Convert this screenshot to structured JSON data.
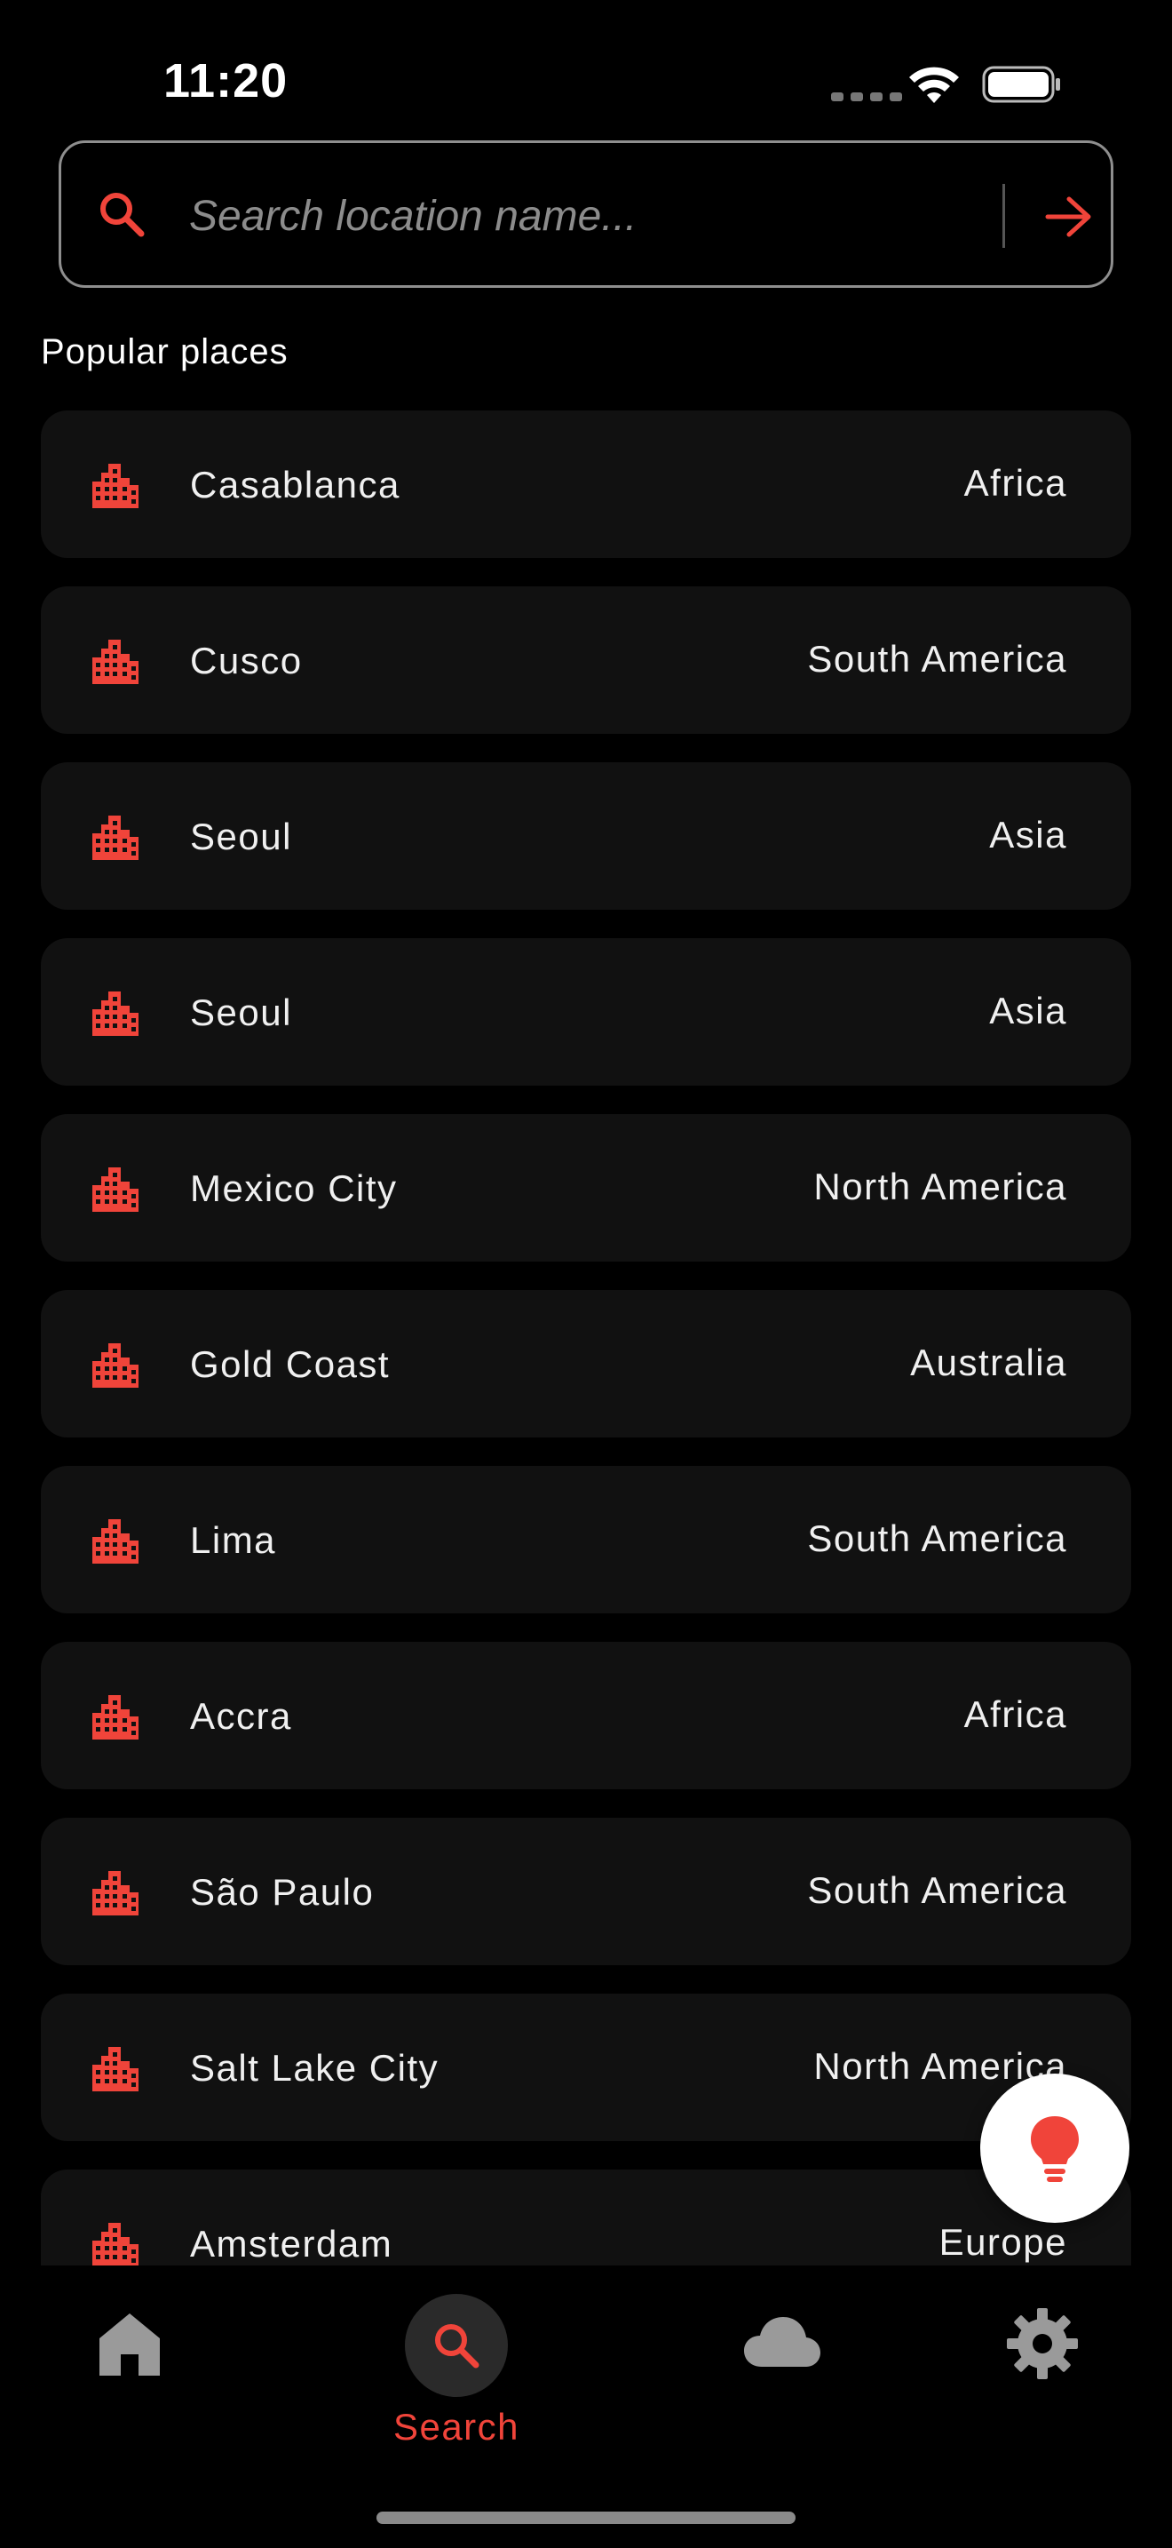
{
  "status_bar": {
    "time": "11:20"
  },
  "search": {
    "placeholder": "Search location name...",
    "value": ""
  },
  "section_title": "Popular places",
  "places": [
    {
      "name": "Casablanca",
      "region": "Africa"
    },
    {
      "name": "Cusco",
      "region": "South America"
    },
    {
      "name": "Seoul",
      "region": "Asia"
    },
    {
      "name": "Seoul",
      "region": "Asia"
    },
    {
      "name": "Mexico City",
      "region": "North America"
    },
    {
      "name": "Gold Coast",
      "region": "Australia"
    },
    {
      "name": "Lima",
      "region": "South America"
    },
    {
      "name": "Accra",
      "region": "Africa"
    },
    {
      "name": "São Paulo",
      "region": "South America"
    },
    {
      "name": "Salt Lake City",
      "region": "North America"
    },
    {
      "name": "Amsterdam",
      "region": "Europe"
    }
  ],
  "place_icon": "city-icon",
  "fab_icon": "lightbulb-icon",
  "nav": {
    "items": [
      {
        "icon": "home-icon",
        "label": ""
      },
      {
        "icon": "search-icon",
        "label": "Search",
        "active": true
      },
      {
        "icon": "cloud-icon",
        "label": ""
      },
      {
        "icon": "gear-icon",
        "label": ""
      }
    ]
  },
  "colors": {
    "accent": "#f0443a",
    "card": "#111111",
    "background": "#000000",
    "icon_inactive": "#9a9a9a"
  }
}
